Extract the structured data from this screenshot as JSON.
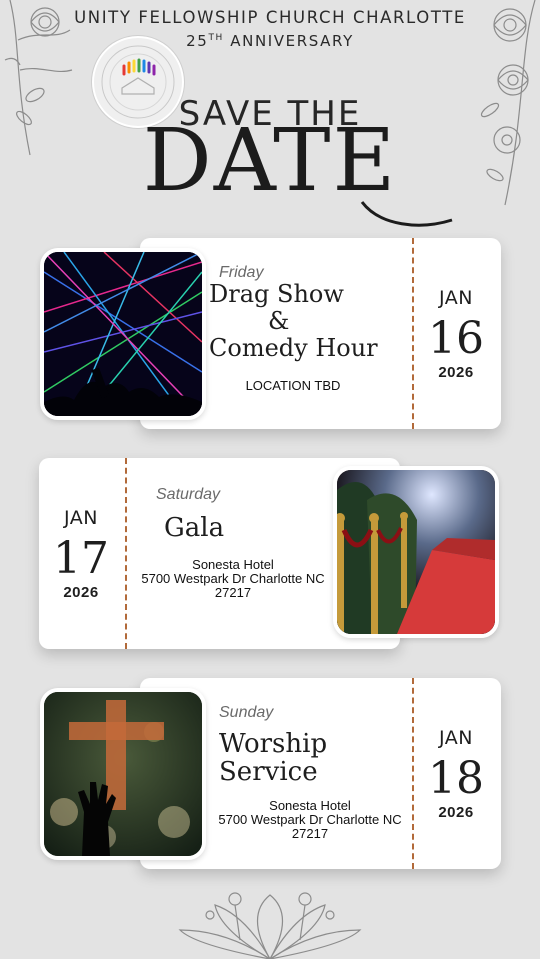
{
  "header": {
    "line1": "UNITY FELLOWSHIP CHURCH CHARLOTTE",
    "ordinal": "25",
    "ordinal_suffix": "TH",
    "line2_rest": "ANNIVERSARY"
  },
  "headline": {
    "save_the": "SAVE THE",
    "date": "DATE"
  },
  "events": [
    {
      "day": "Friday",
      "title_line1": "Drag Show",
      "title_line2": "&",
      "title_line3": "Comedy Hour",
      "location": "LOCATION TBD",
      "month": "JAN",
      "date": "16",
      "year": "2026"
    },
    {
      "day": "Saturday",
      "title_line1": "Gala",
      "venue": "Sonesta Hotel",
      "address_line1": "5700 Westpark Dr Charlotte NC",
      "address_line2": "27217",
      "month": "JAN",
      "date": "17",
      "year": "2026"
    },
    {
      "day": "Sunday",
      "title_line1": "Worship",
      "title_line2": "Service",
      "venue": "Sonesta Hotel",
      "address_line1": "5700 Westpark Dr Charlotte NC",
      "address_line2": "27217",
      "month": "JAN",
      "date": "18",
      "year": "2026"
    }
  ],
  "colors": {
    "background": "#e3e3e3",
    "card": "#ffffff",
    "dash_accent": "#b26a3a"
  },
  "icons": {
    "floral_top_left": "floral-line-art-icon",
    "floral_top_right": "floral-line-art-icon",
    "floral_bottom": "floral-line-art-icon",
    "church_logo": "church-logo-icon"
  }
}
